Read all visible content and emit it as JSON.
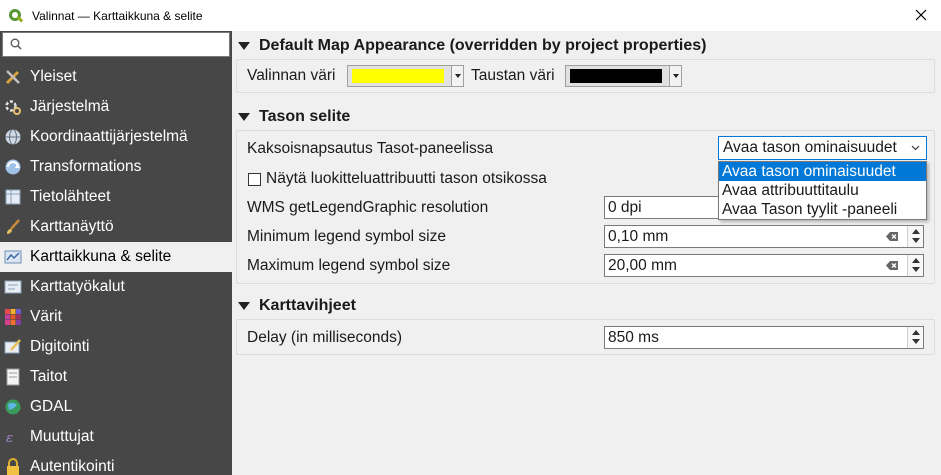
{
  "window": {
    "title": "Valinnat — Karttaikkuna & selite",
    "app_icon": "qgis-icon",
    "close_icon": "close-icon"
  },
  "sidebar": {
    "search_placeholder": "",
    "items": [
      {
        "label": "Yleiset",
        "icon": "tools-icon",
        "selected": false
      },
      {
        "label": "Järjestelmä",
        "icon": "system-icon",
        "selected": false
      },
      {
        "label": "Koordinaattijärjestelmä",
        "icon": "globe-icon",
        "selected": false
      },
      {
        "label": "Transformations",
        "icon": "transform-icon",
        "selected": false
      },
      {
        "label": "Tietolähteet",
        "icon": "table-icon",
        "selected": false
      },
      {
        "label": "Karttanäyttö",
        "icon": "brush-icon",
        "selected": false
      },
      {
        "label": "Karttaikkuna & selite",
        "icon": "map-legend-icon",
        "selected": true
      },
      {
        "label": "Karttatyökalut",
        "icon": "map-tools-icon",
        "selected": false
      },
      {
        "label": "Värit",
        "icon": "colors-icon",
        "selected": false
      },
      {
        "label": "Digitointi",
        "icon": "digitize-icon",
        "selected": false
      },
      {
        "label": "Taitot",
        "icon": "layout-icon",
        "selected": false
      },
      {
        "label": "GDAL",
        "icon": "gdal-icon",
        "selected": false
      },
      {
        "label": "Muuttujat",
        "icon": "variables-icon",
        "selected": false
      },
      {
        "label": "Autentikointi",
        "icon": "lock-icon",
        "selected": false
      }
    ]
  },
  "sections": {
    "map_appearance": {
      "title": "Default Map Appearance (overridden by project properties)",
      "selection_color_label": "Valinnan väri",
      "selection_color": "#ffff00",
      "background_color_label": "Taustan väri",
      "background_color": "#000000"
    },
    "layer_legend": {
      "title": "Tason selite",
      "double_click_label": "Kaksoisnapsautus Tasot-paneelissa",
      "double_click_value": "Avaa tason ominaisuudet",
      "double_click_options": [
        "Avaa tason ominaisuudet",
        "Avaa attribuuttitaulu",
        "Avaa Tason tyylit -paneeli"
      ],
      "show_classification_label": "Näytä luokitteluattribuutti tason otsikossa",
      "show_classification_checked": false,
      "wms_resolution_label": "WMS getLegendGraphic resolution",
      "wms_resolution_value": "0 dpi",
      "min_symbol_label": "Minimum legend symbol size",
      "min_symbol_value": "0,10 mm",
      "max_symbol_label": "Maximum legend symbol size",
      "max_symbol_value": "20,00 mm"
    },
    "map_tips": {
      "title": "Karttavihjeet",
      "delay_label": "Delay (in milliseconds)",
      "delay_value": "850 ms"
    }
  },
  "colors": {
    "sidebar_bg": "#474747",
    "highlight": "#0078d7"
  }
}
